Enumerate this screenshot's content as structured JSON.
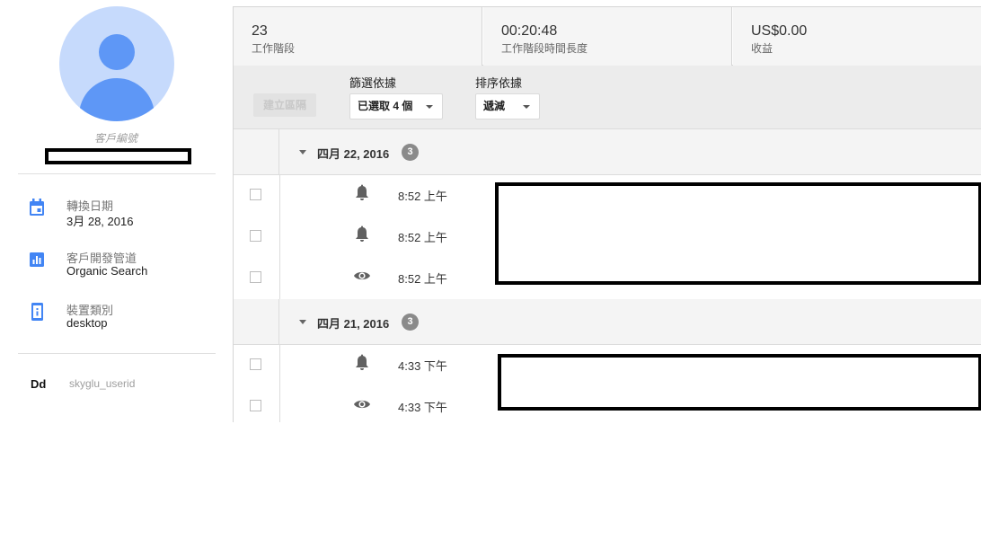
{
  "profile": {
    "client_id_label": "客戶編號",
    "fields": [
      {
        "icon": "calendar-icon",
        "label": "轉換日期",
        "value": "3月 28, 2016"
      },
      {
        "icon": "bar-chart-icon",
        "label": "客戶開發管道",
        "value": "Organic Search"
      },
      {
        "icon": "device-icon",
        "label": "裝置類別",
        "value": "desktop"
      }
    ],
    "dimension_badge": "Dd",
    "dimension_name": "skyglu_userid"
  },
  "stats": [
    {
      "value": "23",
      "label": "工作階段"
    },
    {
      "value": "00:20:48",
      "label": "工作階段時間長度"
    },
    {
      "value": "US$0.00",
      "label": "收益"
    }
  ],
  "toolbar": {
    "create_segment": "建立區隔",
    "filter_label": "篩選依據",
    "filter_value": "已選取 4 個",
    "sort_label": "排序依據",
    "sort_value": "遞減"
  },
  "days": [
    {
      "date": "四月 22, 2016",
      "count": "3",
      "events": [
        {
          "icon": "bell-icon",
          "time": "8:52 上午"
        },
        {
          "icon": "bell-icon",
          "time": "8:52 上午"
        },
        {
          "icon": "eye-icon",
          "time": "8:52 上午"
        }
      ]
    },
    {
      "date": "四月 21, 2016",
      "count": "3",
      "events": [
        {
          "icon": "bell-icon",
          "time": "4:33 下午"
        },
        {
          "icon": "eye-icon",
          "time": "4:33 下午"
        }
      ]
    }
  ],
  "colors": {
    "accent_blue": "#4285f4",
    "avatar_bg": "#c6dafc",
    "avatar_fg": "#5e97f6"
  }
}
